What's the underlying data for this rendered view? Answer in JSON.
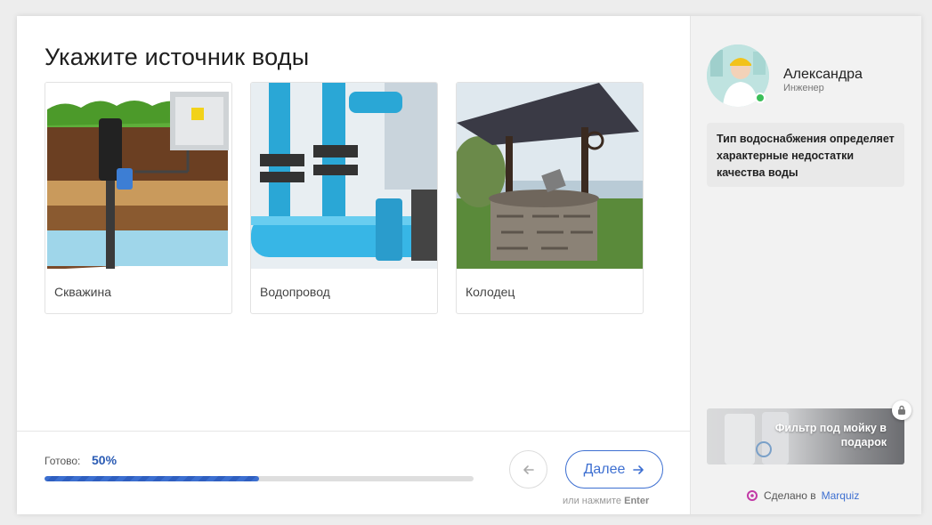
{
  "question": {
    "title": "Укажите источник воды"
  },
  "options": [
    {
      "label": "Скважина",
      "image": "borehole-illustration"
    },
    {
      "label": "Водопровод",
      "image": "water-pipes-photo"
    },
    {
      "label": "Колодец",
      "image": "stone-well-photo"
    }
  ],
  "progress": {
    "label": "Готово:",
    "value_text": "50%",
    "value": 0.5
  },
  "nav": {
    "back_icon": "arrow-left-icon",
    "next_label": "Далее",
    "next_icon": "arrow-right-icon",
    "hint_prefix": "или нажмите",
    "hint_key": "Enter"
  },
  "assistant": {
    "name": "Александра",
    "role": "Инженер",
    "message": "Тип водоснабжения определяет характерные недостатки качества воды"
  },
  "bonus": {
    "text": "Фильтр под мойку в подарок",
    "icon": "lock-icon"
  },
  "footer": {
    "made_by": "Сделано в",
    "brand": "Marquiz"
  },
  "colors": {
    "accent": "#3d6fd1",
    "progress": "#3c6fd0",
    "online": "#3bbf59"
  }
}
